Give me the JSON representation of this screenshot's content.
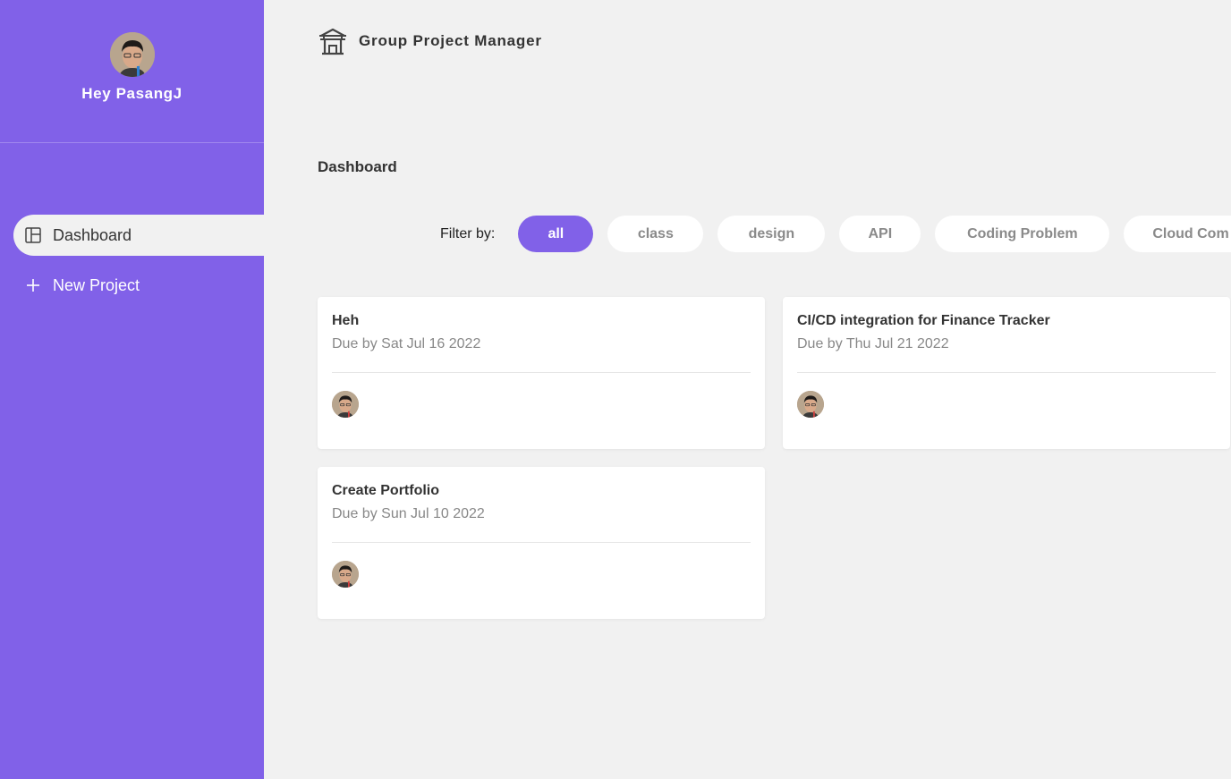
{
  "sidebar": {
    "greeting": "Hey PasangJ",
    "items": [
      {
        "label": "Dashboard",
        "icon": "layout-icon",
        "active": true
      },
      {
        "label": "New Project",
        "icon": "plus-icon",
        "active": false
      }
    ]
  },
  "header": {
    "app_title": "Group Project Manager",
    "logo_icon": "temple-icon"
  },
  "main": {
    "page_title": "Dashboard",
    "filter_label": "Filter by:",
    "filters": [
      "all",
      "class",
      "design",
      "API",
      "Coding Problem",
      "Cloud Com"
    ],
    "active_filter": "all"
  },
  "projects": [
    {
      "title": "Heh",
      "due": "Due by Sat Jul 16 2022"
    },
    {
      "title": "CI/CD integration for Finance Tracker",
      "due": "Due by Thu Jul 21 2022"
    },
    {
      "title": "Create Portfolio",
      "due": "Due by Sun Jul 10 2022"
    }
  ],
  "colors": {
    "accent": "#8161e8",
    "background": "#f1f1f1",
    "card": "#ffffff",
    "muted_text": "#888888"
  }
}
